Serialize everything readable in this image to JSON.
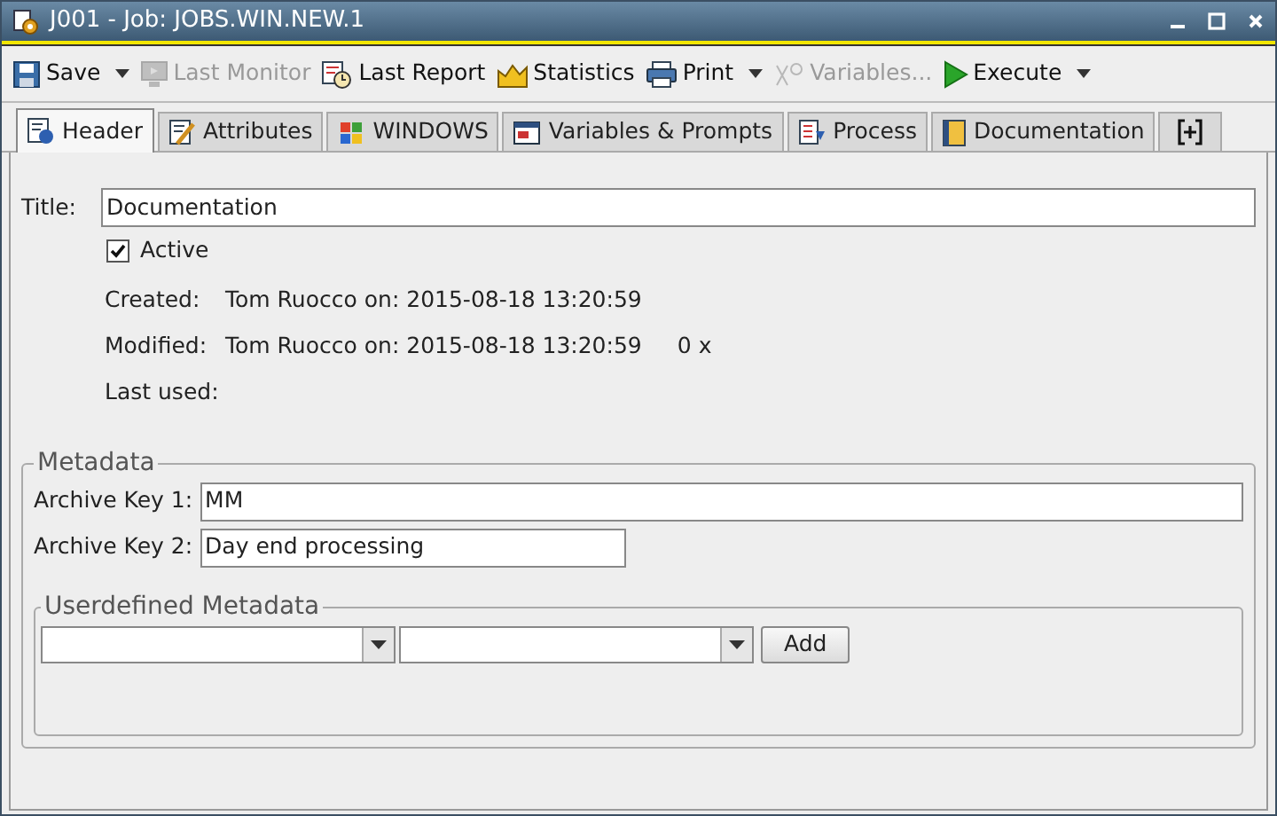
{
  "window": {
    "title": "J001 - Job: JOBS.WIN.NEW.1"
  },
  "toolbar": [
    {
      "kind": "save",
      "label": "Save",
      "disabled": false,
      "dropdown": true
    },
    {
      "kind": "monitor",
      "label": "Last Monitor",
      "disabled": true,
      "dropdown": false
    },
    {
      "kind": "report",
      "label": "Last Report",
      "disabled": false,
      "dropdown": false
    },
    {
      "kind": "statistics",
      "label": "Statistics",
      "disabled": false,
      "dropdown": false
    },
    {
      "kind": "print",
      "label": "Print",
      "disabled": false,
      "dropdown": true
    },
    {
      "kind": "variables",
      "label": "Variables...",
      "disabled": true,
      "dropdown": false
    },
    {
      "kind": "execute",
      "label": "Execute",
      "disabled": false,
      "dropdown": true
    }
  ],
  "tabs": [
    {
      "kind": "header",
      "label": "Header",
      "selected": true
    },
    {
      "kind": "attributes",
      "label": "Attributes",
      "selected": false
    },
    {
      "kind": "windows",
      "label": "WINDOWS",
      "selected": false
    },
    {
      "kind": "variables",
      "label": "Variables & Prompts",
      "selected": false
    },
    {
      "kind": "process",
      "label": "Process",
      "selected": false
    },
    {
      "kind": "documentation",
      "label": "Documentation",
      "selected": false
    },
    {
      "kind": "add",
      "selected": false
    }
  ],
  "header": {
    "title_label": "Title:",
    "title_value": "Documentation",
    "active": {
      "label": "Active",
      "checked": true
    },
    "info": [
      {
        "label": "Created:",
        "value": "Tom Ruocco on: 2015-08-18 13:20:59"
      },
      {
        "label": "Modified:",
        "value": "Tom Ruocco on: 2015-08-18 13:20:59",
        "count": "0 x"
      },
      {
        "label": "Last used:"
      }
    ]
  },
  "metadata": {
    "legend": "Metadata",
    "fields": [
      {
        "label": "Archive Key 1:",
        "value": "MM",
        "wide": true
      },
      {
        "label": "Archive Key 2:",
        "value": "Day end processing",
        "wide": false
      }
    ]
  },
  "userdefined": {
    "legend": "Userdefined Metadata",
    "button": "Add"
  }
}
